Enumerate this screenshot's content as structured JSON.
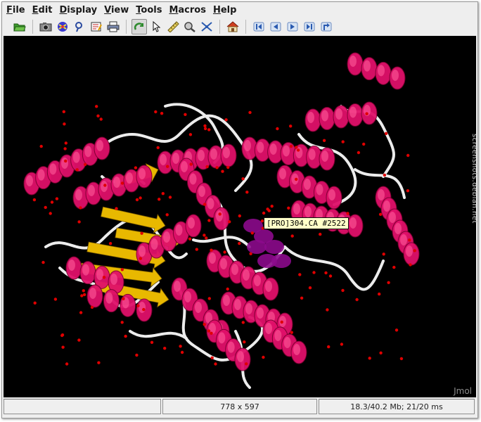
{
  "menu": [
    {
      "pre": "",
      "mn": "F",
      "post": "ile"
    },
    {
      "pre": "",
      "mn": "E",
      "post": "dit"
    },
    {
      "pre": "",
      "mn": "D",
      "post": "isplay"
    },
    {
      "pre": "",
      "mn": "V",
      "post": "iew"
    },
    {
      "pre": "",
      "mn": "T",
      "post": "ools"
    },
    {
      "pre": "",
      "mn": "M",
      "post": "acros"
    },
    {
      "pre": "",
      "mn": "H",
      "post": "elp"
    }
  ],
  "toolbar": {
    "icons": [
      "open-folder-icon",
      "camera-icon",
      "rotate-icon",
      "script-icon",
      "editor-icon",
      "print-icon",
      "rotate-mode-icon",
      "pick-icon",
      "measure-icon",
      "zoom-icon",
      "spin-icon",
      "home-icon",
      "first-frame-icon",
      "previous-frame-icon",
      "next-frame-icon",
      "last-frame-icon",
      "rewind-icon"
    ]
  },
  "viewer": {
    "tooltip": "[PRO]304.CA #2522",
    "brand": "Jmol"
  },
  "status": {
    "left": "",
    "size": "778 x 597",
    "memory": "18.3/40.2 Mb; 21/20 ms"
  },
  "watermark": "screenshots.debian.net",
  "colors": {
    "helix": "#e0106a",
    "sheet": "#e8b800",
    "coil": "#ececec",
    "atom": "#e00000",
    "highlight": "#8c0a8c"
  }
}
